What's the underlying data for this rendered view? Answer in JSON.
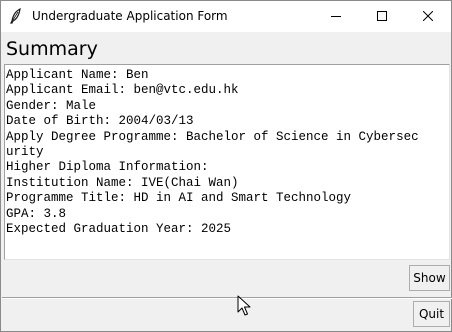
{
  "window": {
    "title": "Undergraduate Application Form",
    "icon": "feather-icon",
    "controls": [
      "minimize-icon",
      "maximize-icon",
      "close-icon"
    ]
  },
  "summary": {
    "heading": "Summary",
    "lines": [
      "Applicant Name: Ben",
      "Applicant Email: ben@vtc.edu.hk",
      "Gender: Male",
      "Date of Birth: 2004/03/13",
      "Apply Degree Programme: Bachelor of Science in Cybersec",
      "urity",
      "Higher Diploma Information:",
      "Institution Name: IVE(Chai Wan)",
      "Programme Title: HD in AI and Smart Technology",
      "GPA: 3.8",
      "Expected Graduation Year: 2025"
    ]
  },
  "buttons": {
    "show_label": "Show",
    "quit_label": "Quit"
  }
}
